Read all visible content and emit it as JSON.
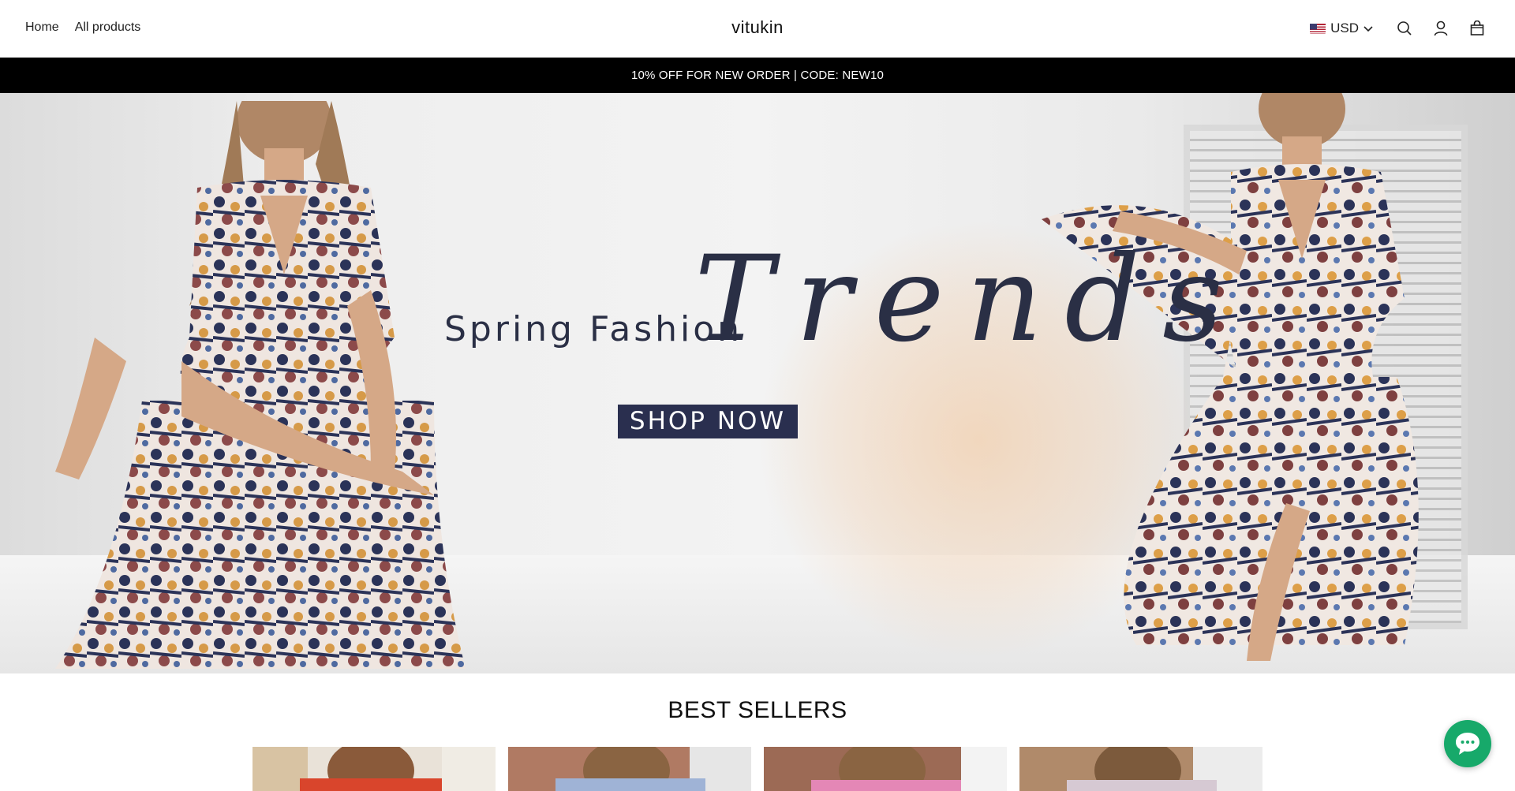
{
  "header": {
    "nav": [
      {
        "label": "Home"
      },
      {
        "label": "All products"
      }
    ],
    "logo": "vitukin",
    "currency": {
      "code": "USD",
      "flag": "us-flag-icon"
    },
    "icons": [
      "search-icon",
      "account-icon",
      "cart-icon"
    ]
  },
  "announcement": {
    "text": "10% OFF FOR NEW ORDER | CODE: NEW10"
  },
  "hero": {
    "line1": "Spring Fashion",
    "line2": "Trends",
    "cta": "SHOP NOW",
    "colors": {
      "text": "#2a2f45",
      "cta_bg": "#2a2f4f",
      "splash": "#f4c496"
    }
  },
  "best_sellers": {
    "title": "BEST SELLERS",
    "products": [
      {
        "image": "product-image-red-top"
      },
      {
        "image": "product-image-blue-striped-top"
      },
      {
        "image": "product-image-pink-top"
      },
      {
        "image": "product-image-floral-top"
      }
    ]
  },
  "chat": {
    "icon": "chat-bubble-icon",
    "color": "#17a96a"
  }
}
